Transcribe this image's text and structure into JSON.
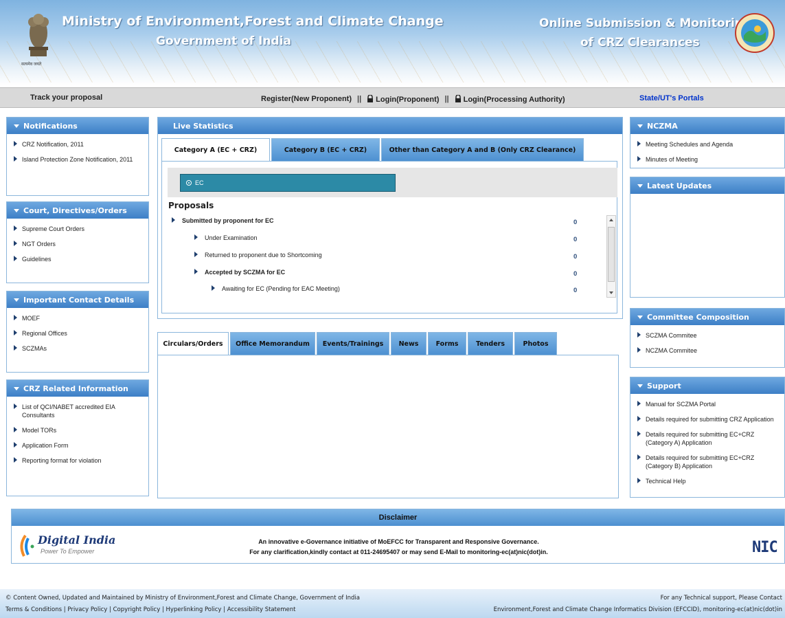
{
  "header": {
    "title_line1": "Ministry of Environment,Forest and Climate Change",
    "title_line2": "Government of India",
    "right_line1": "Online Submission & Monitoring",
    "right_line2": "of CRZ Clearances",
    "emblem_caption": "सत्यमेव जयते"
  },
  "navbar": {
    "track": "Track your proposal",
    "register": "Register(New Proponent)",
    "sep": "||",
    "login_proponent": "Login(Proponent)",
    "login_authority": "Login(Processing Authority)",
    "state_portals": "State/UT's Portals"
  },
  "left_panels": {
    "notifications": {
      "title": "Notifications",
      "items": [
        "CRZ Notification, 2011",
        "Island Protection Zone Notification, 2011"
      ]
    },
    "court": {
      "title": "Court, Directives/Orders",
      "items": [
        "Supreme Court Orders",
        "NGT Orders",
        "Guidelines"
      ]
    },
    "contacts": {
      "title": "Important Contact Details",
      "items": [
        "MOEF",
        "Regional Offices",
        "SCZMAs"
      ]
    },
    "crz_info": {
      "title": "CRZ Related Information",
      "items": [
        "List of QCI/NABET accredited EIA Consultants",
        "Model TORs",
        "Application Form",
        "Reporting format for violation"
      ]
    }
  },
  "live_stats": {
    "title": "Live Statistics",
    "tabs": [
      "Category A (EC + CRZ)",
      "Category B (EC + CRZ)",
      "Other than Category A and B (Only CRZ Clearance)"
    ],
    "ec_label": "EC",
    "proposals_title": "Proposals",
    "rows": [
      {
        "label": "Submitted by proponent for EC",
        "value": "0"
      },
      {
        "label": "Under Examination",
        "value": "0"
      },
      {
        "label": "Returned to proponent due to Shortcoming",
        "value": "0"
      },
      {
        "label": "Accepted by SCZMA for EC",
        "value": "0"
      },
      {
        "label": "Awaiting for EC (Pending for EAC Meeting)",
        "value": "0"
      }
    ]
  },
  "circulars": {
    "tabs": [
      "Circulars/Orders",
      "Office Memorandum",
      "Events/Trainings",
      "News",
      "Forms",
      "Tenders",
      "Photos"
    ]
  },
  "right_panels": {
    "nczma": {
      "title": "NCZMA",
      "items": [
        "Meeting Schedules and Agenda",
        "Minutes of Meeting"
      ]
    },
    "latest": {
      "title": "Latest Updates"
    },
    "committee": {
      "title": "Committee Composition",
      "items": [
        "SCZMA Commitee",
        "NCZMA Commitee"
      ]
    },
    "support": {
      "title": "Support",
      "items": [
        "Manual for SCZMA Portal",
        "Details required for submitting CRZ Application",
        "Details required for submitting EC+CRZ (Category A) Application",
        "Details required for submitting EC+CRZ (Category B) Application",
        "Technical Help"
      ]
    }
  },
  "disclaimer": {
    "title": "Disclaimer",
    "line1": "An innovative e-Governance initiative of MoEFCC for Transparent and Responsive Governance.",
    "line2": "For any clarification,kindly contact at 011-24695407 or may send E-Mail to monitoring-ec(at)nic(dot)in.",
    "digital_india": "Digital India",
    "digital_india_tagline": "Power To Empower",
    "nic": "NIC"
  },
  "footer": {
    "left_line1": "© Content Owned, Updated and Maintained by Ministry of Environment,Forest and Climate Change, Government of India",
    "links": [
      "Terms & Conditions",
      "Privacy Policy",
      "Copyright Policy",
      "Hyperlinking Policy",
      "Accessibility Statement"
    ],
    "right_line1": "For any Technical support, Please Contact",
    "right_line2": "Environment,Forest and Climate Change Informatics Division (EFCCID), monitoring-ec(at)nic(dot)in"
  },
  "colors": {
    "accent": "#3d7fc6",
    "ec_button": "#2c8aa6",
    "link": "#0033cc"
  }
}
